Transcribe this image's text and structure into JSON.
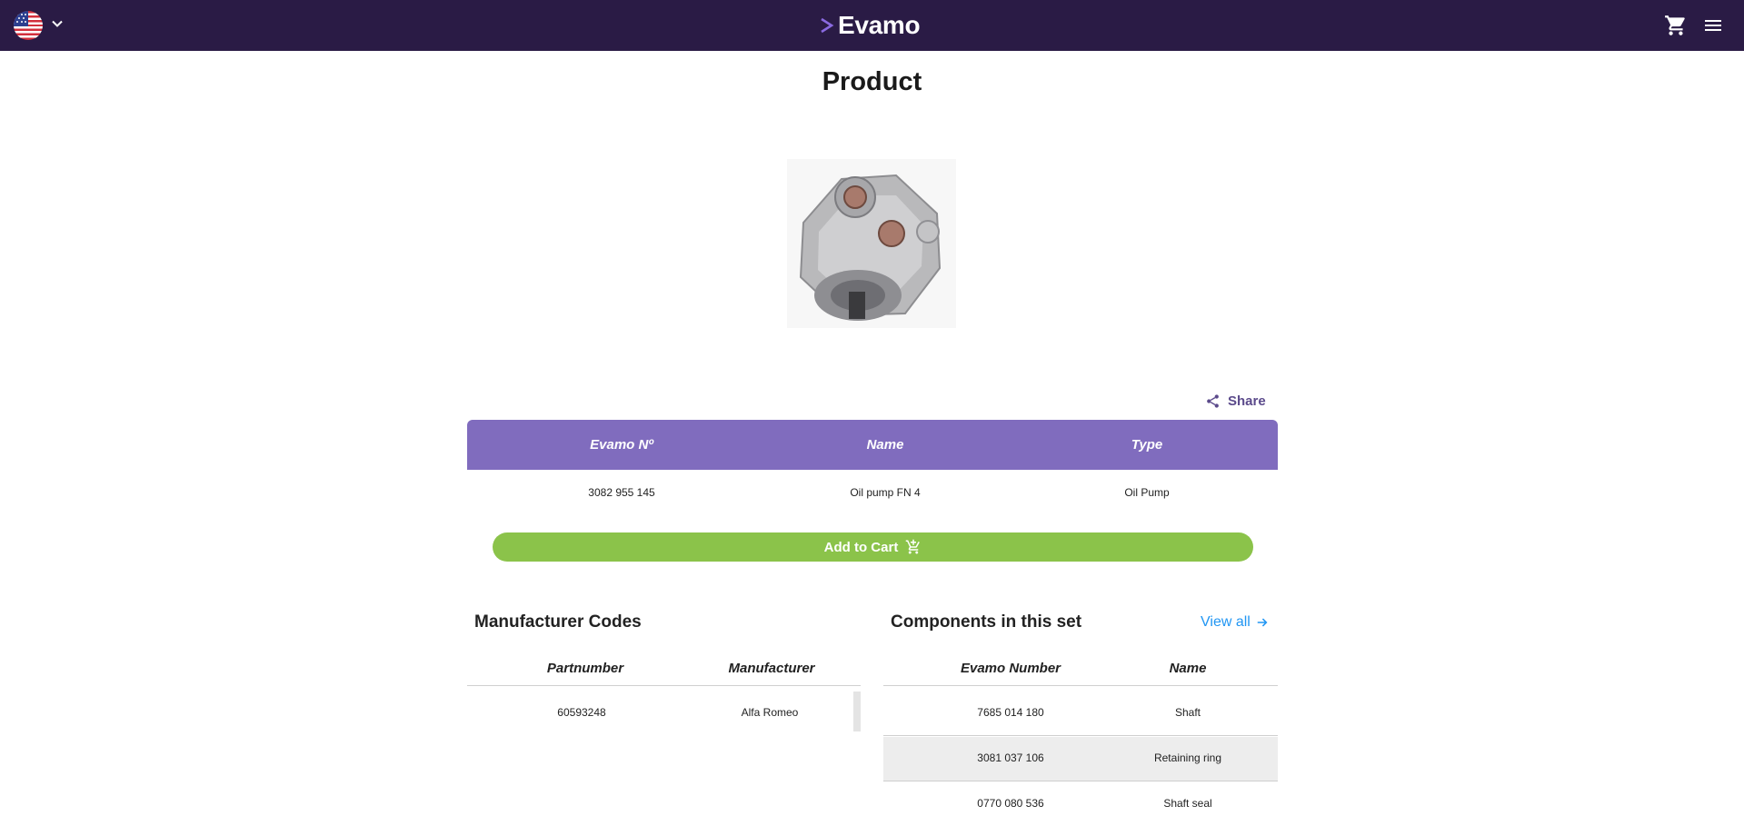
{
  "header": {
    "brand": "Evamo",
    "language_icon": "us-flag-icon",
    "colors": {
      "topbar": "#2a1b45",
      "logo_accent": "#8a6ae0"
    }
  },
  "page": {
    "title": "Product"
  },
  "share": {
    "label": "Share"
  },
  "product_table": {
    "headers": [
      "Evamo Nº",
      "Name",
      "Type"
    ],
    "row": {
      "evamo_no": "3082 955 145",
      "name": "Oil pump FN 4",
      "type": "Oil Pump"
    },
    "header_color": "#806cbe"
  },
  "add_to_cart": {
    "label": "Add to Cart",
    "color": "#8bc34a"
  },
  "manufacturer_codes": {
    "title": "Manufacturer Codes",
    "headers": [
      "Partnumber",
      "Manufacturer"
    ],
    "rows": [
      {
        "partnumber": "60593248",
        "manufacturer": "Alfa Romeo"
      }
    ]
  },
  "components": {
    "title": "Components in this set",
    "view_all": "View all",
    "headers": [
      "Evamo Number",
      "Name"
    ],
    "rows": [
      {
        "number": "7685 014 180",
        "name": "Shaft"
      },
      {
        "number": "3081 037 106",
        "name": "Retaining ring"
      },
      {
        "number": "0770 080 536",
        "name": "Shaft seal"
      }
    ]
  }
}
